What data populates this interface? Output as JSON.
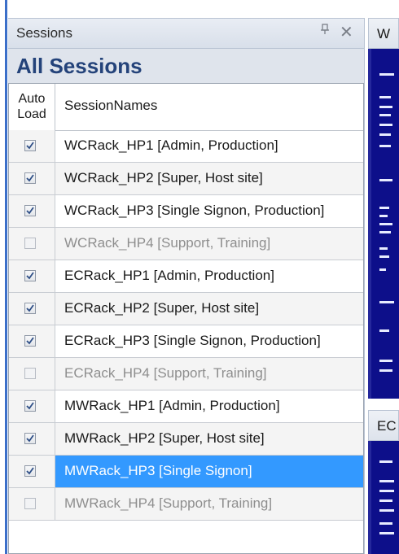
{
  "panel": {
    "title": "Sessions",
    "pin_glyph": "ྷ",
    "close_glyph": "✕",
    "heading": "All Sessions"
  },
  "grid": {
    "col_auto_line1": "Auto",
    "col_auto_line2": "Load",
    "col_names": "SessionNames",
    "rows": [
      {
        "name": "WCRack_HP1 [Admin, Production]",
        "checked": true
      },
      {
        "name": "WCRack_HP2 [Super, Host site]",
        "checked": true
      },
      {
        "name": "WCRack_HP3 [Single Signon, Production]",
        "checked": true
      },
      {
        "name": "WCRack_HP4 [Support, Training]",
        "checked": false
      },
      {
        "name": "ECRack_HP1 [Admin, Production]",
        "checked": true
      },
      {
        "name": "ECRack_HP2 [Super, Host site]",
        "checked": true
      },
      {
        "name": "ECRack_HP3 [Single Signon, Production]",
        "checked": true
      },
      {
        "name": "ECRack_HP4 [Support, Training]",
        "checked": false
      },
      {
        "name": "MWRack_HP1 [Admin, Production]",
        "checked": true
      },
      {
        "name": "MWRack_HP2 [Super, Host site]",
        "checked": true
      },
      {
        "name": "MWRack_HP3 [Single Signon]",
        "checked": true,
        "selected": true
      },
      {
        "name": "MWRack_HP4 [Support, Training]",
        "checked": false
      }
    ]
  },
  "right_panels": {
    "tab1_label": "W",
    "tab2_label": "EC"
  },
  "colors": {
    "heading": "#24437a",
    "selection": "#3399ff",
    "console_bg": "#0d0f8a"
  }
}
